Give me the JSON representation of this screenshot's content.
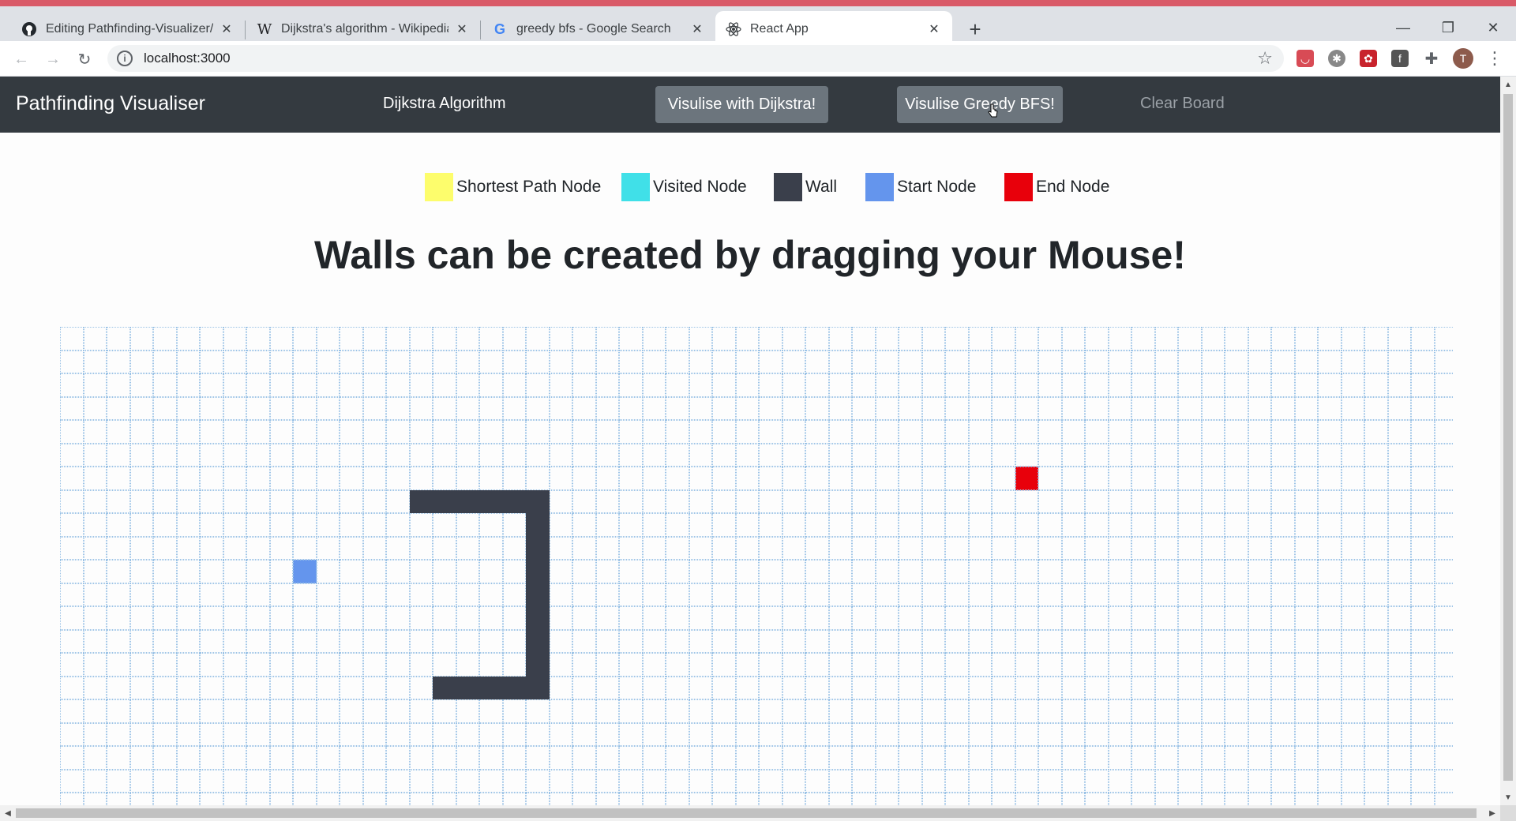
{
  "browser": {
    "tabs": [
      {
        "title": "Editing Pathfinding-Visualizer/RE",
        "icon": "github-icon",
        "active": false
      },
      {
        "title": "Dijkstra's algorithm - Wikipedia",
        "icon": "wikipedia-icon",
        "active": false
      },
      {
        "title": "greedy bfs - Google Search",
        "icon": "google-icon",
        "active": false
      },
      {
        "title": "React App",
        "icon": "react-icon",
        "active": true
      }
    ],
    "url": "localhost:3000",
    "profile_initial": "T",
    "accent_color": "#d95a68"
  },
  "app": {
    "brand": "Pathfinding Visualiser",
    "algorithm": "Dijkstra Algorithm",
    "visualise_dijkstra": "Visulise with Dijkstra!",
    "visualise_greedy": "Visulise Greedy BFS!",
    "clear_board": "Clear Board",
    "heading": "Walls can be created by dragging your Mouse!",
    "legend": [
      {
        "label": "Shortest Path Node",
        "color": "#fdfd6c"
      },
      {
        "label": "Visited Node",
        "color": "#40e0e8"
      },
      {
        "label": "Wall",
        "color": "#3a3f4b"
      },
      {
        "label": "Start Node",
        "color": "#6495ed"
      },
      {
        "label": "End Node",
        "color": "#e8000b"
      }
    ],
    "grid": {
      "rows": 21,
      "cols": 60,
      "start": {
        "row": 10,
        "col": 10
      },
      "end": {
        "row": 6,
        "col": 41
      },
      "walls": [
        [
          7,
          15
        ],
        [
          7,
          16
        ],
        [
          7,
          17
        ],
        [
          7,
          18
        ],
        [
          7,
          19
        ],
        [
          7,
          20
        ],
        [
          8,
          20
        ],
        [
          9,
          20
        ],
        [
          10,
          20
        ],
        [
          11,
          20
        ],
        [
          12,
          20
        ],
        [
          13,
          20
        ],
        [
          14,
          20
        ],
        [
          15,
          20
        ],
        [
          15,
          16
        ],
        [
          15,
          17
        ],
        [
          15,
          18
        ],
        [
          15,
          19
        ]
      ],
      "colors": {
        "wall": "#3a3f4b",
        "start": "#6495ed",
        "end": "#e8000b",
        "grid_line": "#9cc3e6"
      }
    }
  }
}
